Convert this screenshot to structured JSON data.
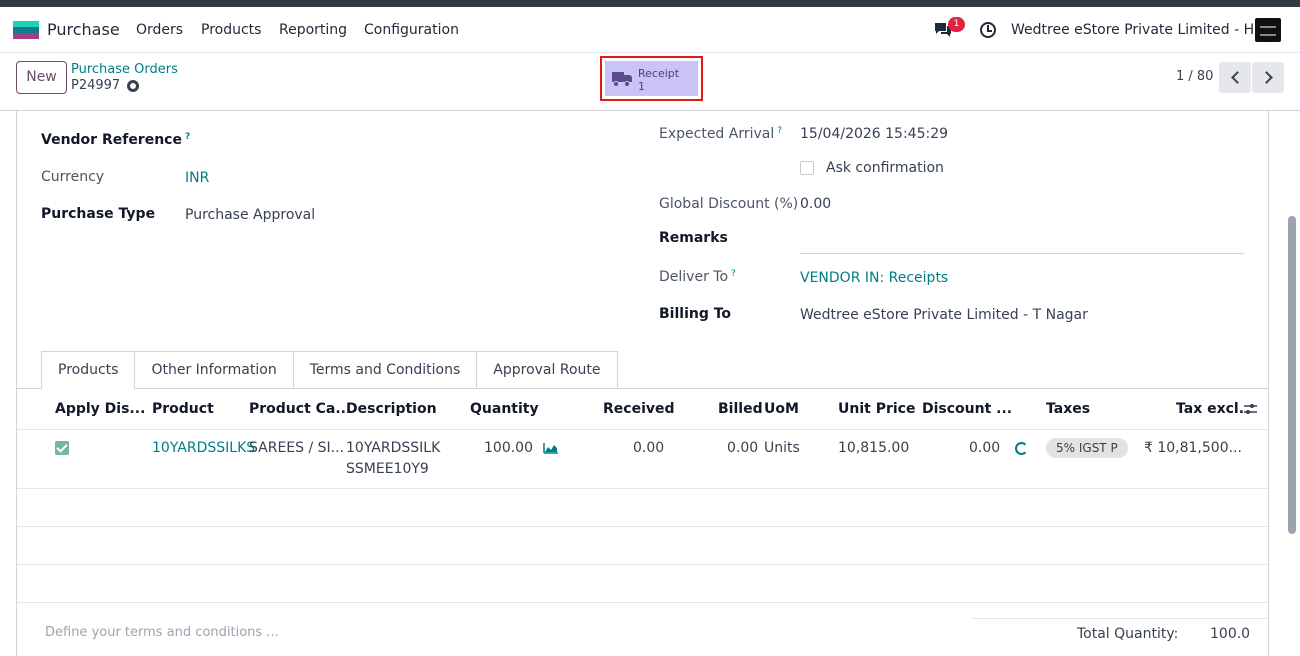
{
  "app": {
    "name": "Purchase",
    "menu": [
      "Orders",
      "Products",
      "Reporting",
      "Configuration"
    ],
    "notification_count": "1",
    "company": "Wedtree eStore Private Limited - HO"
  },
  "control": {
    "new_label": "New",
    "breadcrumb_parent": "Purchase Orders",
    "record_name": "P24997",
    "smart_button": {
      "label": "Receipt",
      "value": "1"
    },
    "pager": "1 / 80"
  },
  "form": {
    "vendor_reference_label": "Vendor Reference",
    "currency_label": "Currency",
    "currency_value": "INR",
    "purchase_type_label": "Purchase Type",
    "purchase_type_value": "Purchase Approval",
    "expected_arrival_label": "Expected Arrival",
    "expected_arrival_value": "15/04/2026 15:45:29",
    "ask_confirmation_label": "Ask confirmation",
    "global_discount_label": "Global Discount (%)",
    "global_discount_value": "0.00",
    "remarks_label": "Remarks",
    "deliver_to_label": "Deliver To",
    "deliver_to_value": "VENDOR IN: Receipts",
    "billing_to_label": "Billing To",
    "billing_to_value": "Wedtree eStore Private Limited - T Nagar",
    "help_mark": "?"
  },
  "tabs": [
    "Products",
    "Other Information",
    "Terms and Conditions",
    "Approval Route"
  ],
  "table": {
    "headers": [
      "Apply Dis...",
      "Product",
      "Product Ca...",
      "Description",
      "Quantity",
      "Received",
      "Billed",
      "UoM",
      "Unit Price",
      "Discount ...",
      "Taxes",
      "Tax excl."
    ],
    "row": {
      "product": "10YARDSSILKS",
      "category": "SAREES / SI...",
      "description_line1": "10YARDSSILK",
      "description_line2": "SSMEE10Y9",
      "quantity": "100.00",
      "received": "0.00",
      "billed": "0.00",
      "uom": "Units",
      "unit_price": "10,815.00",
      "discount": "0.00",
      "tax": "5% IGST P",
      "tax_excl": "₹ 10,81,500..."
    }
  },
  "footer": {
    "terms_placeholder": "Define your terms and conditions ...",
    "total_quantity_label": "Total Quantity:",
    "total_quantity_value": "100.0"
  },
  "colors": {
    "brand": "#714b67",
    "link": "#017e84",
    "highlight": "#e01919",
    "smart_bg": "#c9c4f5"
  }
}
